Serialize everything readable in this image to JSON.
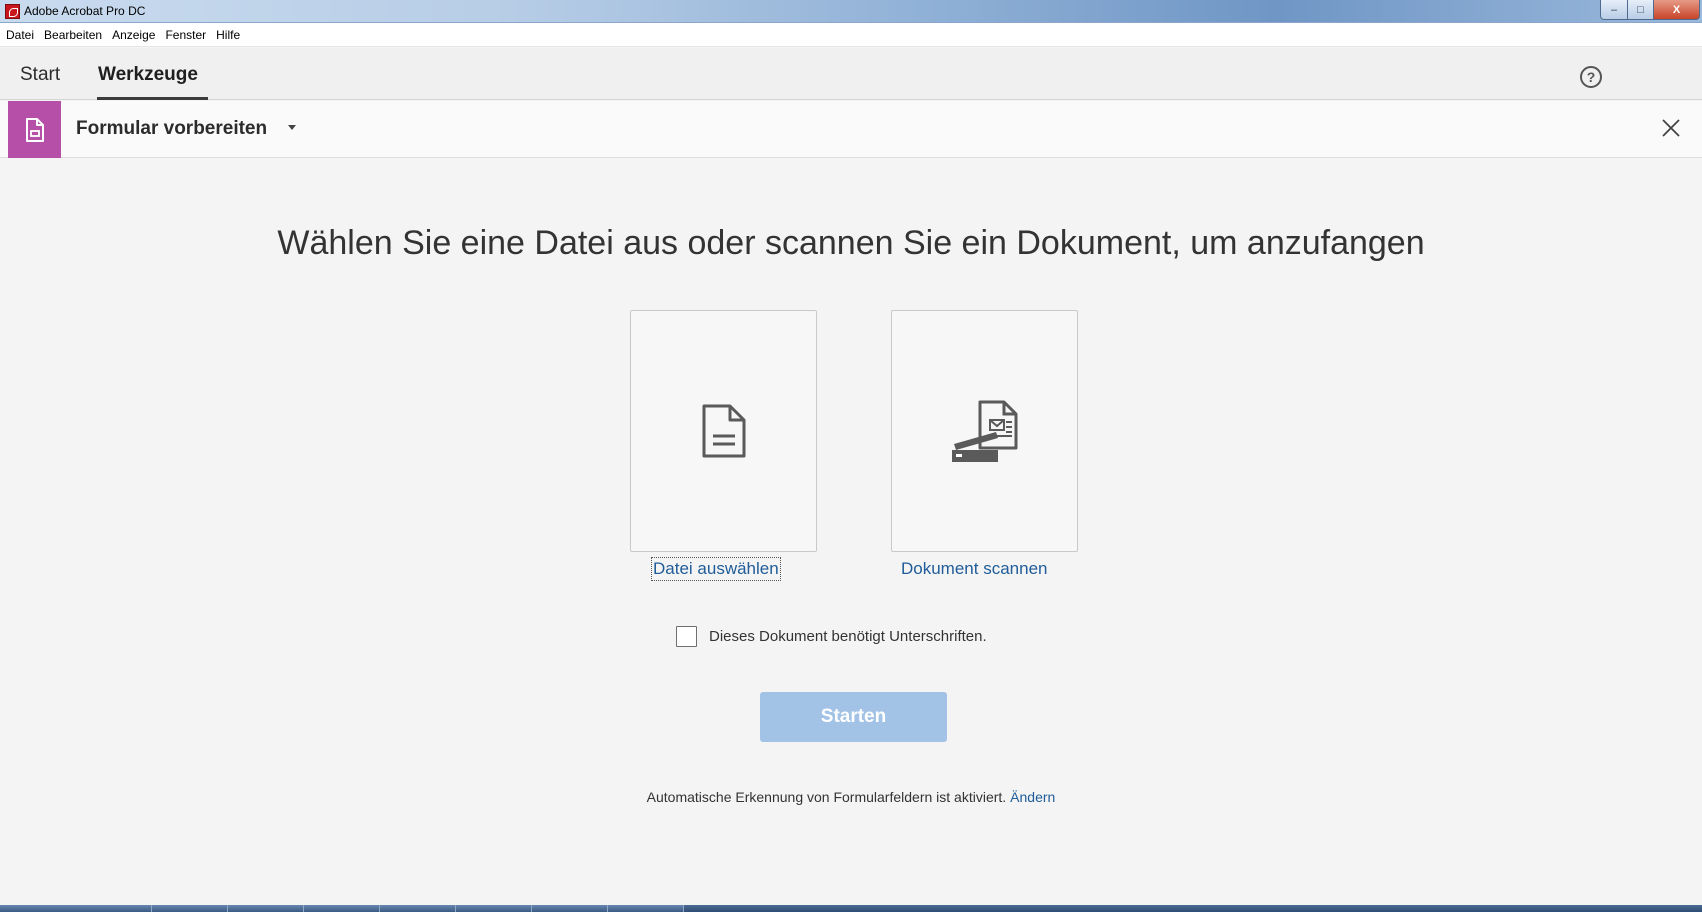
{
  "window": {
    "title": "Adobe Acrobat Pro DC",
    "app_icon": "acrobat-icon",
    "controls": {
      "minimize": "–",
      "maximize": "□",
      "close": "X"
    }
  },
  "menubar": {
    "items": [
      {
        "label": "Datei"
      },
      {
        "label": "Bearbeiten"
      },
      {
        "label": "Anzeige"
      },
      {
        "label": "Fenster"
      },
      {
        "label": "Hilfe"
      }
    ]
  },
  "tabs": {
    "start": "Start",
    "tools": "Werkzeuge",
    "active": "Werkzeuge"
  },
  "help": {
    "glyph": "?"
  },
  "tool": {
    "title": "Formular vorbereiten",
    "icon": "form-icon",
    "accent": "#b64fa8",
    "close_glyph": "×"
  },
  "main": {
    "headline": "Wählen Sie eine Datei aus oder scannen Sie ein Dokument, um anzufangen",
    "options": [
      {
        "label": "Datei auswählen",
        "icon": "document-icon"
      },
      {
        "label": "Dokument scannen",
        "icon": "scanner-icon"
      }
    ],
    "signature_checkbox": {
      "label": "Dieses Dokument benötigt Unterschriften.",
      "checked": false
    },
    "start_button": "Starten",
    "start_button_color": "#a2c3e6",
    "footer_note": "Automatische Erkennung von Formularfeldern ist aktiviert.",
    "change_link": "Ändern",
    "link_color": "#1f5c99"
  }
}
